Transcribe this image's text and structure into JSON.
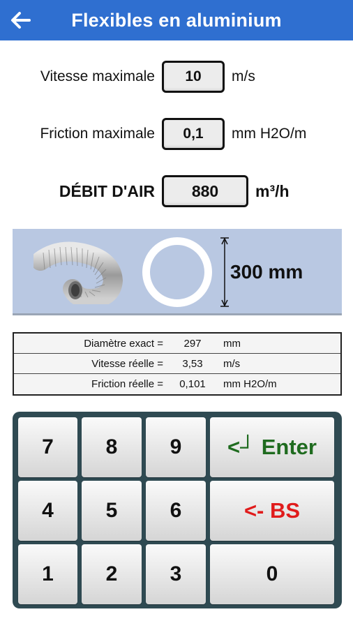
{
  "header": {
    "title": "Flexibles en aluminium"
  },
  "inputs": [
    {
      "label": "Vitesse maximale",
      "value": "10",
      "unit": "m/s"
    },
    {
      "label": "Friction maximale",
      "value": "0,1",
      "unit": "mm H2O/m"
    },
    {
      "label": "DÉBIT D'AIR",
      "value": "880",
      "unit": "m³/h"
    }
  ],
  "illustration": {
    "dimension": "300 mm"
  },
  "results": [
    {
      "label": "Diamètre exact =",
      "value": "297",
      "unit": "mm"
    },
    {
      "label": "Vitesse réelle =",
      "value": "3,53",
      "unit": "m/s"
    },
    {
      "label": "Friction réelle =",
      "value": "0,101",
      "unit": "mm H2O/m"
    }
  ],
  "keypad": {
    "k7": "7",
    "k8": "8",
    "k9": "9",
    "k4": "4",
    "k5": "5",
    "k6": "6",
    "k1": "1",
    "k2": "2",
    "k3": "3",
    "k0": "0",
    "enter": "<┘ Enter",
    "bs": "<- BS"
  },
  "colors": {
    "appbar": "#2f6fd0",
    "panel": "#b9c8e2",
    "keypad_bg": "#2f4a52",
    "enter_text": "#1f6b1f",
    "bs_text": "#e01b1b"
  }
}
